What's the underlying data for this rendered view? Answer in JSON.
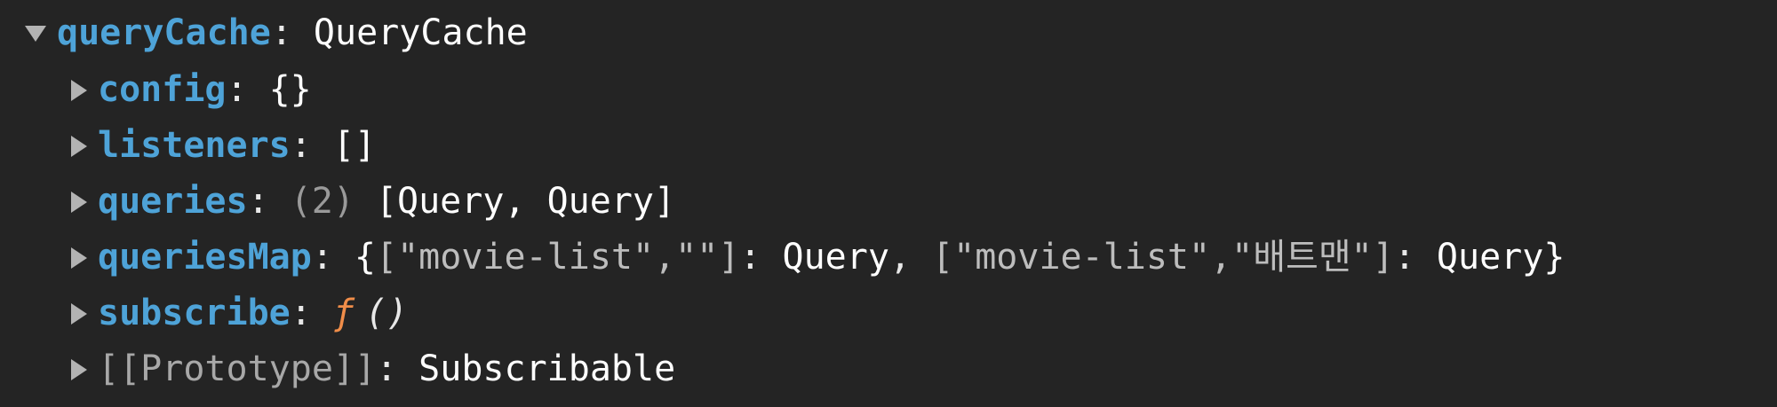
{
  "tree": {
    "root": {
      "key": "queryCache",
      "value": "QueryCache"
    },
    "children": {
      "config": {
        "key": "config",
        "value": "{}"
      },
      "listeners": {
        "key": "listeners",
        "value": "[]"
      },
      "queries": {
        "key": "queries",
        "count": "(2)",
        "value": "[Query, Query]"
      },
      "queriesMap": {
        "key": "queriesMap",
        "open_brace": "{",
        "entry1_key": "[\"movie-list\",\"\"]",
        "entry1_value": "Query",
        "entry2_key": "[\"movie-list\",\"배트맨\"]",
        "entry2_value": "Query",
        "close_brace": "}"
      },
      "subscribe": {
        "key": "subscribe",
        "fn_symbol": "ƒ",
        "fn_args": "()"
      },
      "prototype": {
        "key": "[[Prototype]]",
        "value": "Subscribable"
      }
    }
  },
  "colors": {
    "background": "#242424",
    "key": "#4ea3d8",
    "function": "#f08d49",
    "muted": "#9a9a9a"
  },
  "icons": {
    "expanded": "triangle-down-icon",
    "collapsed": "triangle-right-icon"
  }
}
